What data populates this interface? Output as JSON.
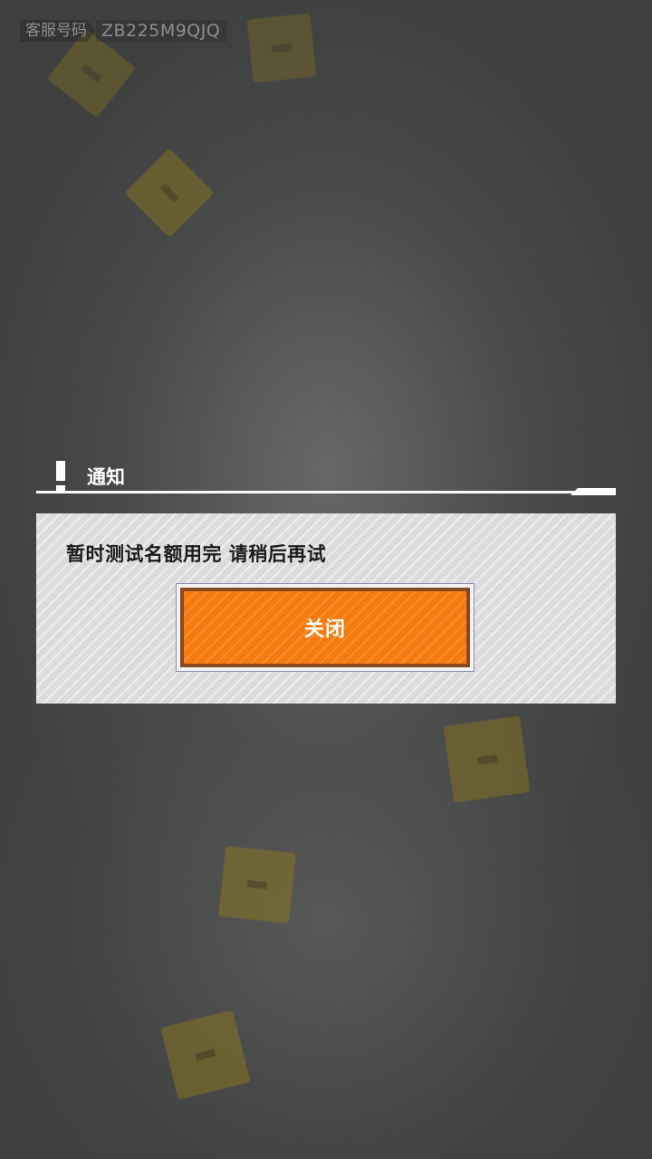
{
  "service_code": {
    "label": "客服号码",
    "value": "ZB225M9QJQ"
  },
  "notice": {
    "title": "通知",
    "icon": "exclamation-icon",
    "message": "暂时测试名额用完  请稍后再试",
    "close_button_label": "关闭"
  },
  "background": {
    "decor_icon": "floating-block-icon"
  },
  "colors": {
    "accent": "#f57a10",
    "accent_border": "#8a4a20",
    "panel": "#dcdcdc",
    "text_dark": "#1a1a1a"
  }
}
